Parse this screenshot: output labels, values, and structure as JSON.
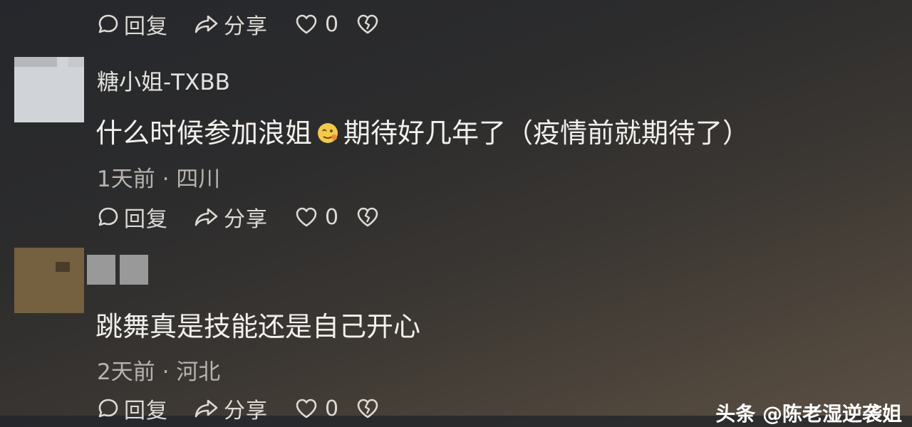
{
  "comments": [
    {
      "actions": {
        "reply": "回复",
        "share": "分享",
        "likes": "0"
      }
    },
    {
      "username": "糖小姐-TXBB",
      "text_before_emoji": "什么时候参加浪姐",
      "emoji": "face-emoji",
      "text_after_emoji": "期待好几年了（疫情前就期待了）",
      "meta": "1天前 · 四川",
      "actions": {
        "reply": "回复",
        "share": "分享",
        "likes": "0"
      }
    },
    {
      "username": "",
      "text": "跳舞真是技能还是自己开心",
      "meta": "2天前 · 河北",
      "actions": {
        "reply": "回复",
        "share": "分享",
        "likes": "0"
      }
    }
  ],
  "watermark": "头条 @陈老湿逆袭姐",
  "icons": {
    "reply": "comment-bubble-icon",
    "share": "share-arrow-icon",
    "like": "heart-outline-icon",
    "dislike": "broken-heart-icon"
  },
  "colors": {
    "text_primary": "#f2f0ec",
    "text_meta": "#b7b3ae",
    "emoji": "#f2c94c"
  }
}
